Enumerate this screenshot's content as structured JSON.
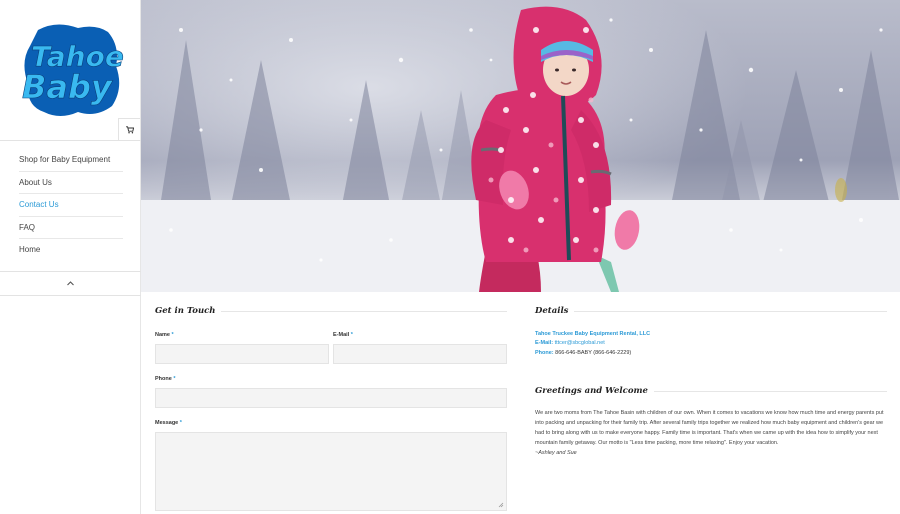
{
  "logo": {
    "line1": "Tahoe",
    "line2": "Baby"
  },
  "sidebar": {
    "cart_icon": "shopping-cart-icon",
    "items": [
      {
        "label": "Shop for Baby Equipment",
        "active": false
      },
      {
        "label": "About Us",
        "active": false
      },
      {
        "label": "Contact Us",
        "active": true
      },
      {
        "label": "FAQ",
        "active": false
      },
      {
        "label": "Home",
        "active": false
      }
    ],
    "collapse_icon": "chevron-up-icon"
  },
  "form": {
    "title": "Get in Touch",
    "name_label": "Name",
    "email_label": "E-Mail",
    "phone_label": "Phone",
    "message_label": "Message",
    "required_mark": "*",
    "name_value": "",
    "email_value": "",
    "phone_value": "",
    "message_value": ""
  },
  "details": {
    "title": "Details",
    "company": "Tahoe Truckee Baby Equipment Rental, LLC",
    "email_label": "E-Mail:",
    "email_value": "tttcer@sbcglobal.net",
    "phone_label": "Phone:",
    "phone_value": "866-646-BABY (866-646-2229)"
  },
  "greetings": {
    "title": "Greetings and Welcome",
    "body": "We are two moms from The Tahoe Basin with children of our own. When it comes to vacations we know how much time and energy parents put into packing and unpacking for their family trip. After several family trips together we realized how much baby equipment and children's gear we had to bring along with us to make everyone happy. Family time is important. That's when we came up with the idea how to simplify your next mountain family getaway. Our motto is \"Less time packing, more time relaxing\". Enjoy your vacation.",
    "signature": "~Ashley and Sue"
  },
  "colors": {
    "accent": "#2b9ad6",
    "logo_blue": "#0a5fb4",
    "logo_light": "#39b9f0",
    "jacket": "#d8306e"
  }
}
